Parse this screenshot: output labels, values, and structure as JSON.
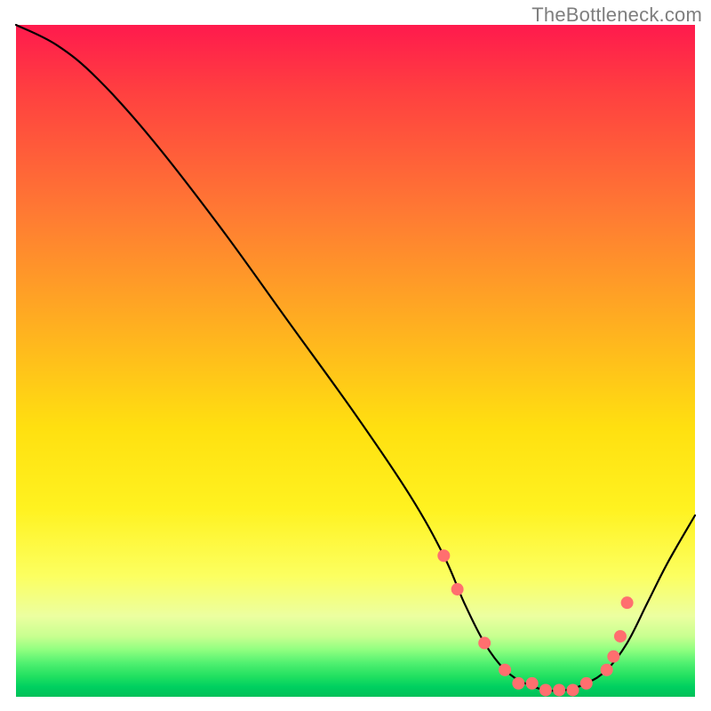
{
  "watermark": "TheBottleneck.com",
  "colors": {
    "marker": "#ff6f6f",
    "curve": "#000000",
    "gradient_top": "#ff1a4d",
    "gradient_bottom": "#00c058"
  },
  "chart_data": {
    "type": "line",
    "title": "",
    "xlabel": "",
    "ylabel": "",
    "xlim": [
      0,
      100
    ],
    "ylim": [
      0,
      100
    ],
    "grid": false,
    "legend": false,
    "series": [
      {
        "name": "curve",
        "x": [
          0,
          6,
          12,
          20,
          30,
          40,
          50,
          58,
          63,
          66,
          69,
          72,
          75,
          78,
          81,
          84,
          87,
          90,
          93,
          96,
          100
        ],
        "y": [
          100,
          97,
          92,
          83,
          70,
          56,
          42,
          30,
          21,
          14,
          8,
          4,
          2,
          1,
          1,
          2,
          4,
          8,
          14,
          20,
          27
        ]
      }
    ],
    "markers": {
      "name": "highlighted-points",
      "x": [
        63,
        65,
        69,
        72,
        74,
        76,
        78,
        80,
        82,
        84,
        87,
        88,
        89,
        90
      ],
      "y": [
        21,
        16,
        8,
        4,
        2,
        2,
        1,
        1,
        1,
        2,
        4,
        6,
        9,
        14
      ]
    }
  }
}
